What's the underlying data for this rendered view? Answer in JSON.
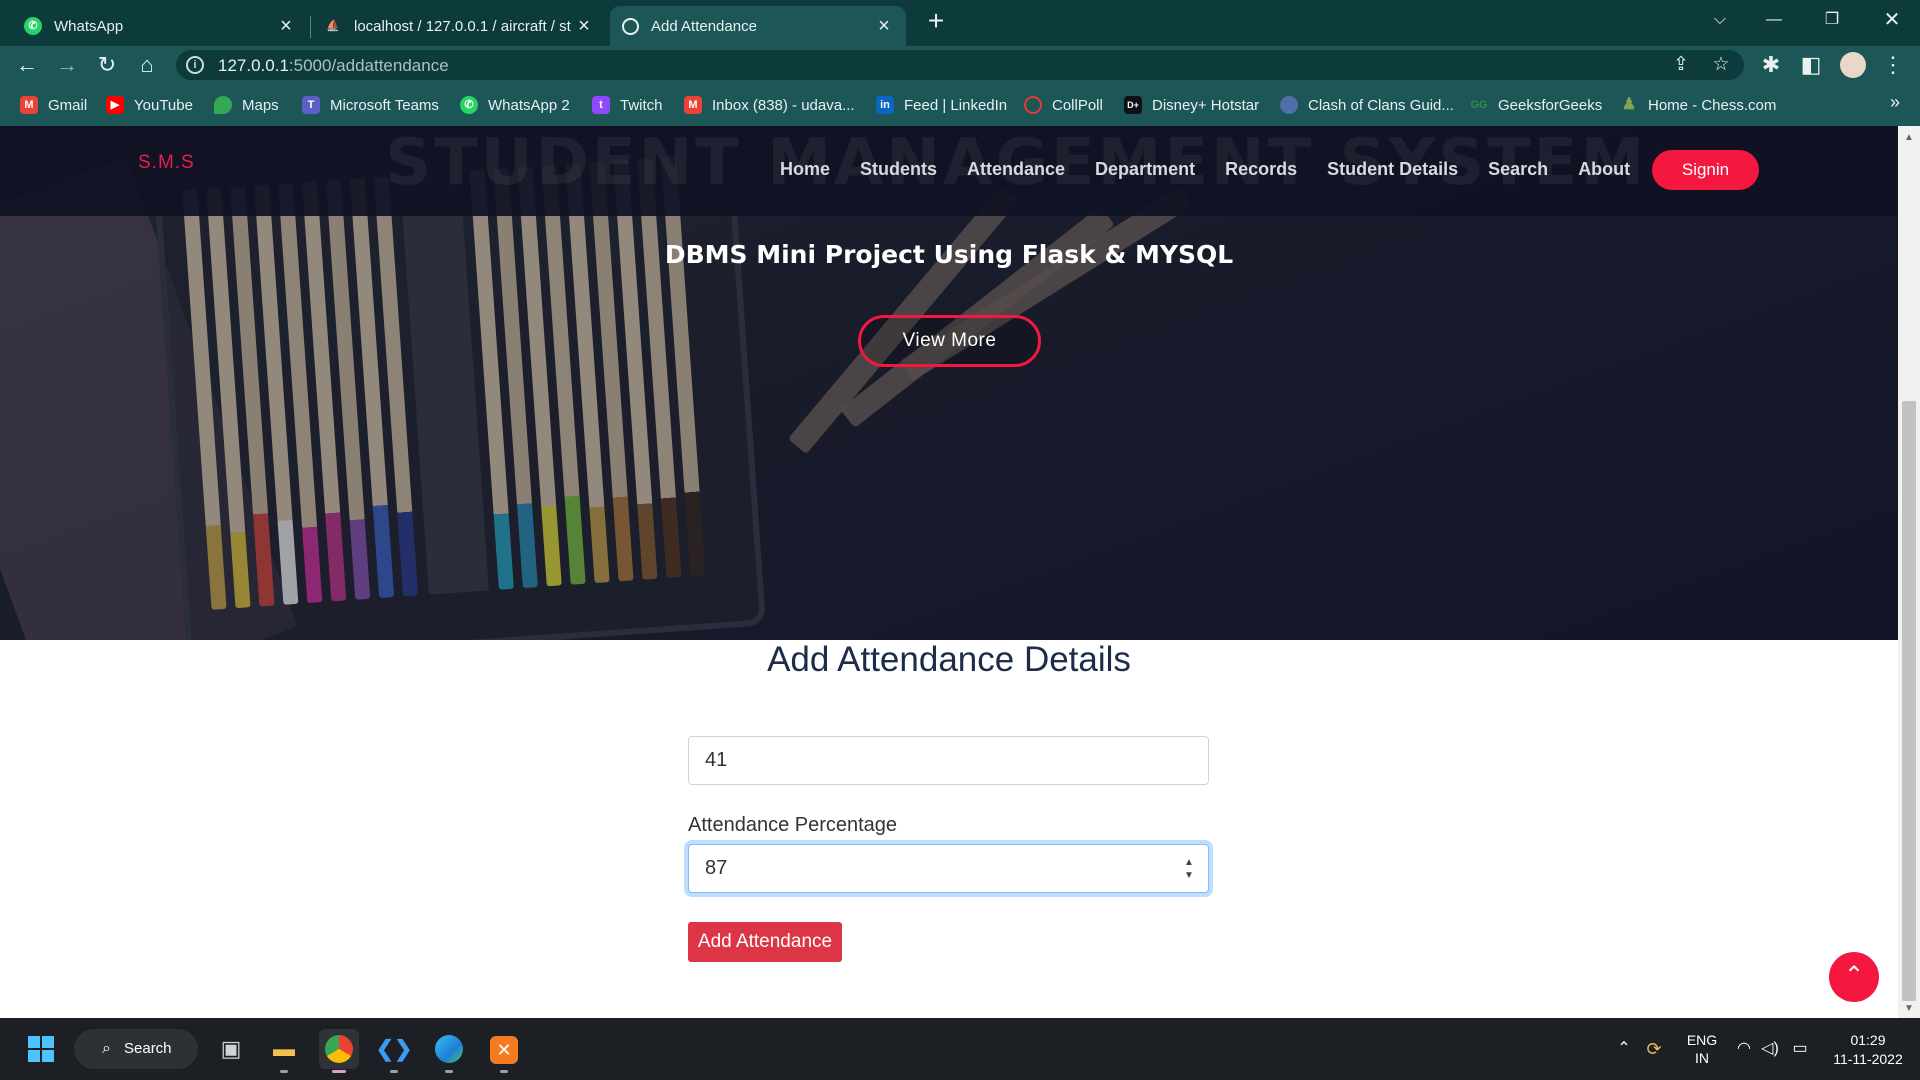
{
  "browser": {
    "tabs": [
      {
        "title": "WhatsApp",
        "icon": "whatsapp-icon",
        "active": false
      },
      {
        "title": "localhost / 127.0.0.1 / aircraft / st",
        "icon": "phpmyadmin-icon",
        "active": false
      },
      {
        "title": "Add Attendance",
        "icon": "globe-icon",
        "active": true
      }
    ],
    "url_host": "127.0.0.1",
    "url_path": ":5000/addattendance",
    "bookmarks": [
      {
        "label": "Gmail",
        "icon": "gmail-icon",
        "color": "#ea4335"
      },
      {
        "label": "YouTube",
        "icon": "youtube-icon",
        "color": "#ff0000"
      },
      {
        "label": "Maps",
        "icon": "maps-icon",
        "color": "#34a853"
      },
      {
        "label": "Microsoft Teams",
        "icon": "teams-icon",
        "color": "#5b5fc7"
      },
      {
        "label": "WhatsApp 2",
        "icon": "whatsapp-icon",
        "color": "#25d366"
      },
      {
        "label": "Twitch",
        "icon": "twitch-icon",
        "color": "#9146ff"
      },
      {
        "label": "Inbox (838) - udava...",
        "icon": "gmail-icon",
        "color": "#ea4335"
      },
      {
        "label": "Feed | LinkedIn",
        "icon": "linkedin-icon",
        "color": "#0a66c2"
      },
      {
        "label": "CollPoll",
        "icon": "collpoll-icon",
        "color": "#e53935"
      },
      {
        "label": "Disney+ Hotstar",
        "icon": "hotstar-icon",
        "color": "#0f1014"
      },
      {
        "label": "Clash of Clans Guid...",
        "icon": "clash-icon",
        "color": "#4f6fa8"
      },
      {
        "label": "GeeksforGeeks",
        "icon": "gfg-icon",
        "color": "#2f8d46"
      },
      {
        "label": "Home - Chess.com",
        "icon": "chess-icon",
        "color": "#7fa650"
      }
    ],
    "more_label": "»"
  },
  "site": {
    "brand": "S.M.S",
    "watermark": "STUDENT MANAGEMENT SYSTEM",
    "menu": [
      "Home",
      "Students",
      "Attendance",
      "Department",
      "Records",
      "Student Details",
      "Search",
      "About"
    ],
    "signin": "Signin",
    "hero_title": "DBMS Mini Project Using Flask & MYSQL",
    "view_more": "View More"
  },
  "form": {
    "title": "Add Attendance Details",
    "roll_value": "41",
    "percentage_label": "Attendance Percentage",
    "percentage_value": "87",
    "submit_label": "Add Attendance"
  },
  "taskbar": {
    "search_label": "Search",
    "lang_top": "ENG",
    "lang_bottom": "IN",
    "time": "01:29",
    "date": "11-11-2022"
  },
  "colors": {
    "tab_strip": "#0d3b3b",
    "toolbar": "#1d5656",
    "accent_red": "#f4173f",
    "button_red": "#dc3545",
    "nav_bg": "#101224"
  }
}
